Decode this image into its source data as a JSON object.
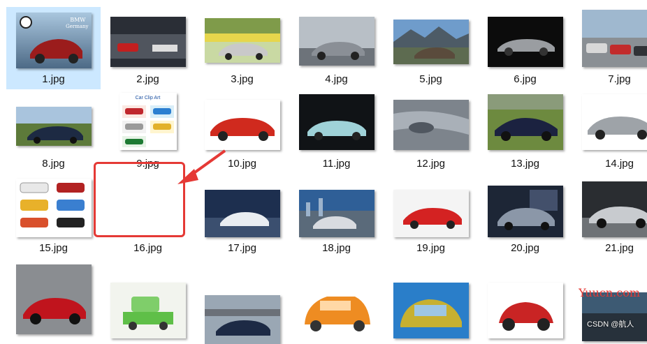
{
  "files": [
    {
      "label": "1.jpg"
    },
    {
      "label": "2.jpg"
    },
    {
      "label": "3.jpg"
    },
    {
      "label": "4.jpg"
    },
    {
      "label": "5.jpg"
    },
    {
      "label": "6.jpg"
    },
    {
      "label": "7.jpg"
    },
    {
      "label": "8.jpg"
    },
    {
      "label": "9.jpg"
    },
    {
      "label": "10.jpg"
    },
    {
      "label": "11.jpg"
    },
    {
      "label": "12.jpg"
    },
    {
      "label": "13.jpg"
    },
    {
      "label": "14.jpg"
    },
    {
      "label": "15.jpg"
    },
    {
      "label": "16.jpg"
    },
    {
      "label": "17.jpg"
    },
    {
      "label": "18.jpg"
    },
    {
      "label": "19.jpg"
    },
    {
      "label": "20.jpg"
    },
    {
      "label": "21.jpg"
    }
  ],
  "thumb_text": {
    "bmw_line1": "BMW",
    "bmw_line2": "Germany",
    "clipart_title": "Car Clip Art"
  },
  "watermark": "Yuucn.com",
  "csdn_mark": "CSDN @航人",
  "colors": {
    "selection": "#cce8ff",
    "annotation": "#e53935"
  }
}
